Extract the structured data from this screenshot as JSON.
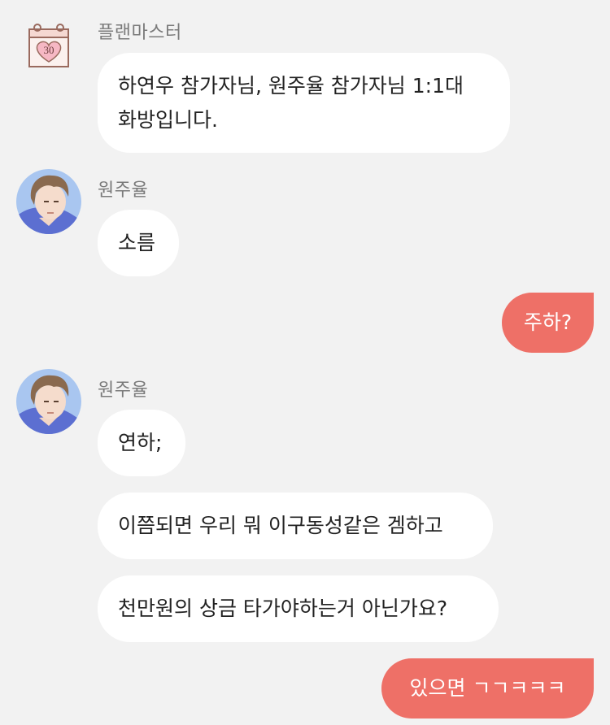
{
  "messages": [
    {
      "sender": "플랜마스터",
      "lines": [
        "하연우 참가자님, 원주율 참가자님 1:1대",
        "화방입니다."
      ]
    },
    {
      "sender": "원주율",
      "text": "소름"
    },
    {
      "sender": "me",
      "text": "주하?"
    },
    {
      "sender": "원주율",
      "texts": [
        "연하;",
        "이쯤되면 우리 뭐 이구동성같은 겜하고",
        "천만원의 상금 타가야하는거 아닌가요?"
      ]
    },
    {
      "sender": "me",
      "text": "있으면 ㄱㄱㅋㅋㅋ"
    }
  ],
  "calendar_icon": {
    "number": "30"
  },
  "colors": {
    "background": "#f2f2f2",
    "my_bubble": "#ee7067",
    "their_bubble": "#ffffff"
  }
}
